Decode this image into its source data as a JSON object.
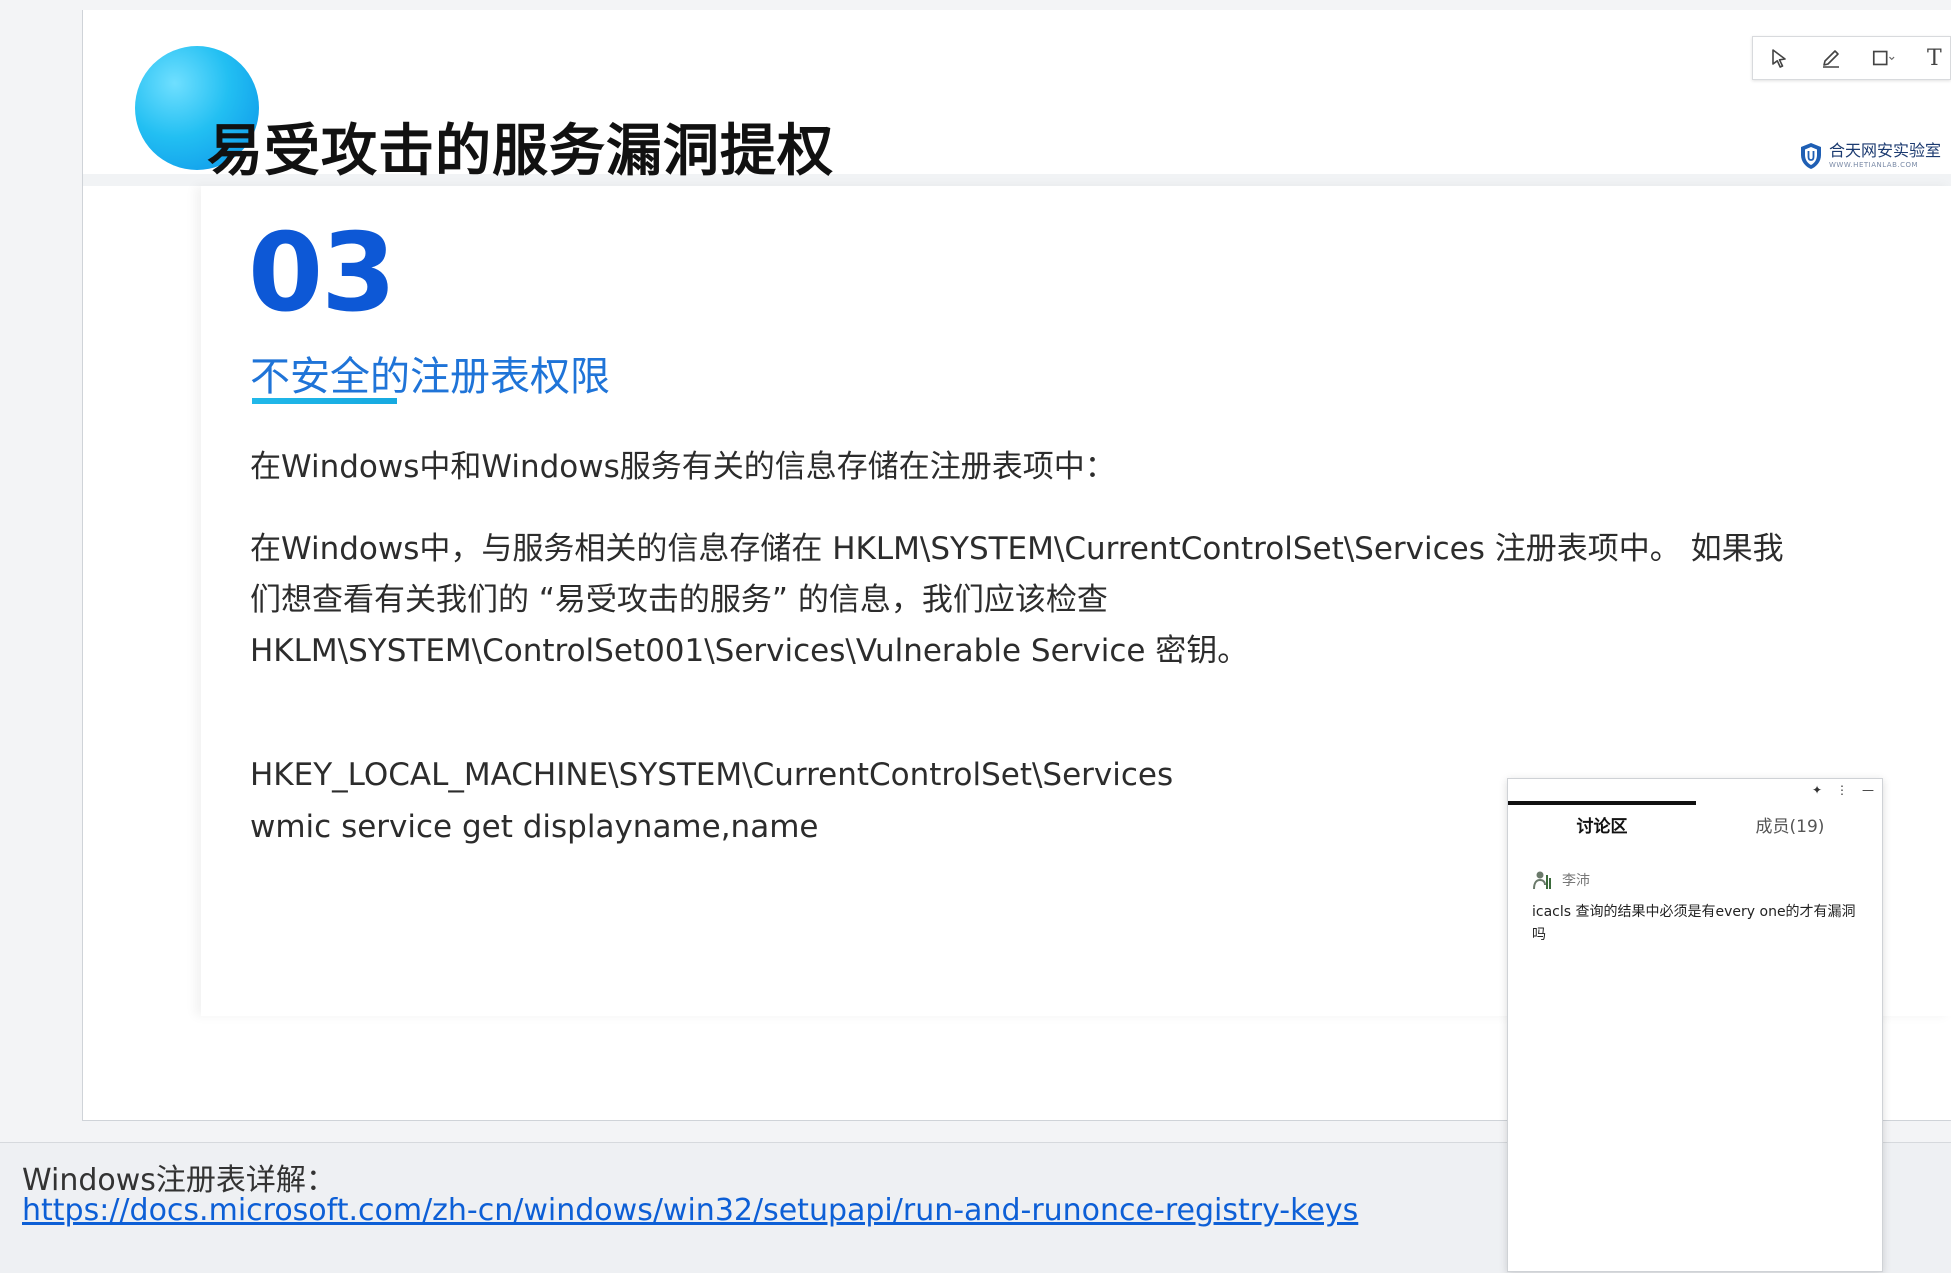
{
  "slide": {
    "title": "易受攻击的服务漏洞提权",
    "brand_name": "合天网安实验室",
    "brand_sub": "WWW.HETIANLAB.COM",
    "section_number": "03",
    "section_title": "不安全的注册表权限",
    "paragraphs": [
      "在Windows中和Windows服务有关的信息存储在注册表项中：",
      "在Windows中，与服务相关的信息存储在 HKLM\\SYSTEM\\CurrentControlSet\\Services 注册表项中。 如果我",
      "们想查看有关我们的 “易受攻击的服务” 的信息，我们应该检查",
      "HKLM\\SYSTEM\\ControlSet001\\Services\\Vulnerable Service 密钥。",
      "HKEY_LOCAL_MACHINE\\SYSTEM\\CurrentControlSet\\Services",
      "wmic service get displayname,name"
    ]
  },
  "reference": {
    "label": "Windows注册表详解：",
    "url": "https://docs.microsoft.com/zh-cn/windows/win32/setupapi/run-and-runonce-registry-keys"
  },
  "toolbar": {
    "tools": [
      "select-arrow-icon",
      "pen-icon",
      "rectangle-icon",
      "text-icon"
    ],
    "text_tool_glyph": "T"
  },
  "discussion": {
    "tabs": {
      "discussion": "讨论区",
      "members": "成员(19)"
    },
    "controls": {
      "pin": "✦",
      "more": "⋮",
      "minimize": "—"
    },
    "messages": [
      {
        "user": "李沛",
        "text": "icacls 查询的结果中必须是有every one的才有漏洞吗"
      }
    ]
  },
  "colors": {
    "accent_blue": "#0d58d6",
    "title_blue": "#1f74d8",
    "underline_cyan": "#21b8e9",
    "link_blue": "#0d5fd6"
  }
}
